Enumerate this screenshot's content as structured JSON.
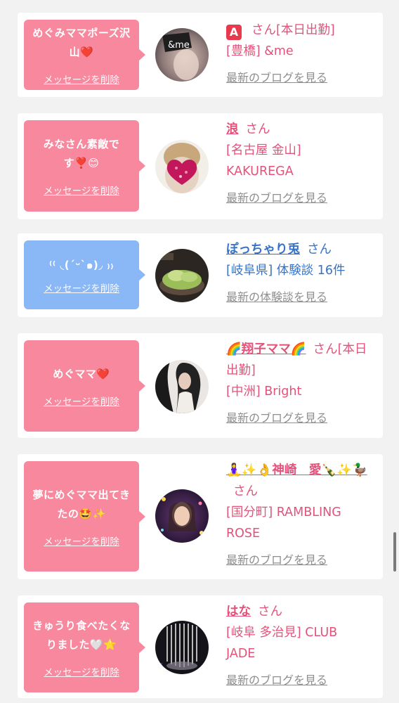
{
  "items": [
    {
      "message": "めぐみママポーズ沢山❤️",
      "delete_label": "メッセージを削除",
      "name": "🅰️",
      "suffix": "さん[本日出勤]",
      "shop": "[豊橋] &me",
      "link": "最新のブログを見る",
      "bubble_color": "#f7889e",
      "avatar_label": "&me"
    },
    {
      "message": "みなさん素敵です❣️😊",
      "delete_label": "メッセージを削除",
      "name": "浪",
      "suffix": "さん",
      "shop": "[名古屋 金山] KAKUREGA",
      "link": "最新のブログを見る",
      "bubble_color": "#f7889e"
    },
    {
      "message": "⁽⁽ ◟(ˊᵕˋ๑)◞ ₎₎",
      "delete_label": "メッセージを削除",
      "name": "ぽっちゃり兎",
      "suffix": "さん",
      "shop": "[岐阜県] 体験談 16件",
      "link": "最新の体験談を見る",
      "bubble_color": "#8ab7f5"
    },
    {
      "message": "めぐママ❤️",
      "delete_label": "メッセージを削除",
      "name": "🌈翔子ママ🌈",
      "suffix": "さん[本日出勤]",
      "shop": "[中洲] Bright",
      "link": "最新のブログを見る",
      "bubble_color": "#f7889e"
    },
    {
      "message": "夢にめぐママ出てきたの🤩✨",
      "delete_label": "メッセージを削除",
      "name": "🧘‍♀️✨👌神崎　愛🍾✨🦆",
      "suffix": "さん",
      "shop": "[国分町] RAMBLING ROSE",
      "link": "最新のブログを見る",
      "bubble_color": "#f7889e"
    },
    {
      "message": "きゅうり食べたくなりました🤍⭐️",
      "delete_label": "メッセージを削除",
      "name": "はな",
      "suffix": "さん",
      "shop": "[岐阜 多治見] CLUB JADE",
      "link": "最新のブログを見る",
      "bubble_color": "#f7889e"
    }
  ],
  "colors": {
    "accent_pink": "#e3527a",
    "bubble_pink": "#f7889e",
    "bubble_blue": "#8ab7f5",
    "link_blue": "#3673c8",
    "link_gray": "#8e8e8e",
    "background": "#f2f2f2"
  }
}
